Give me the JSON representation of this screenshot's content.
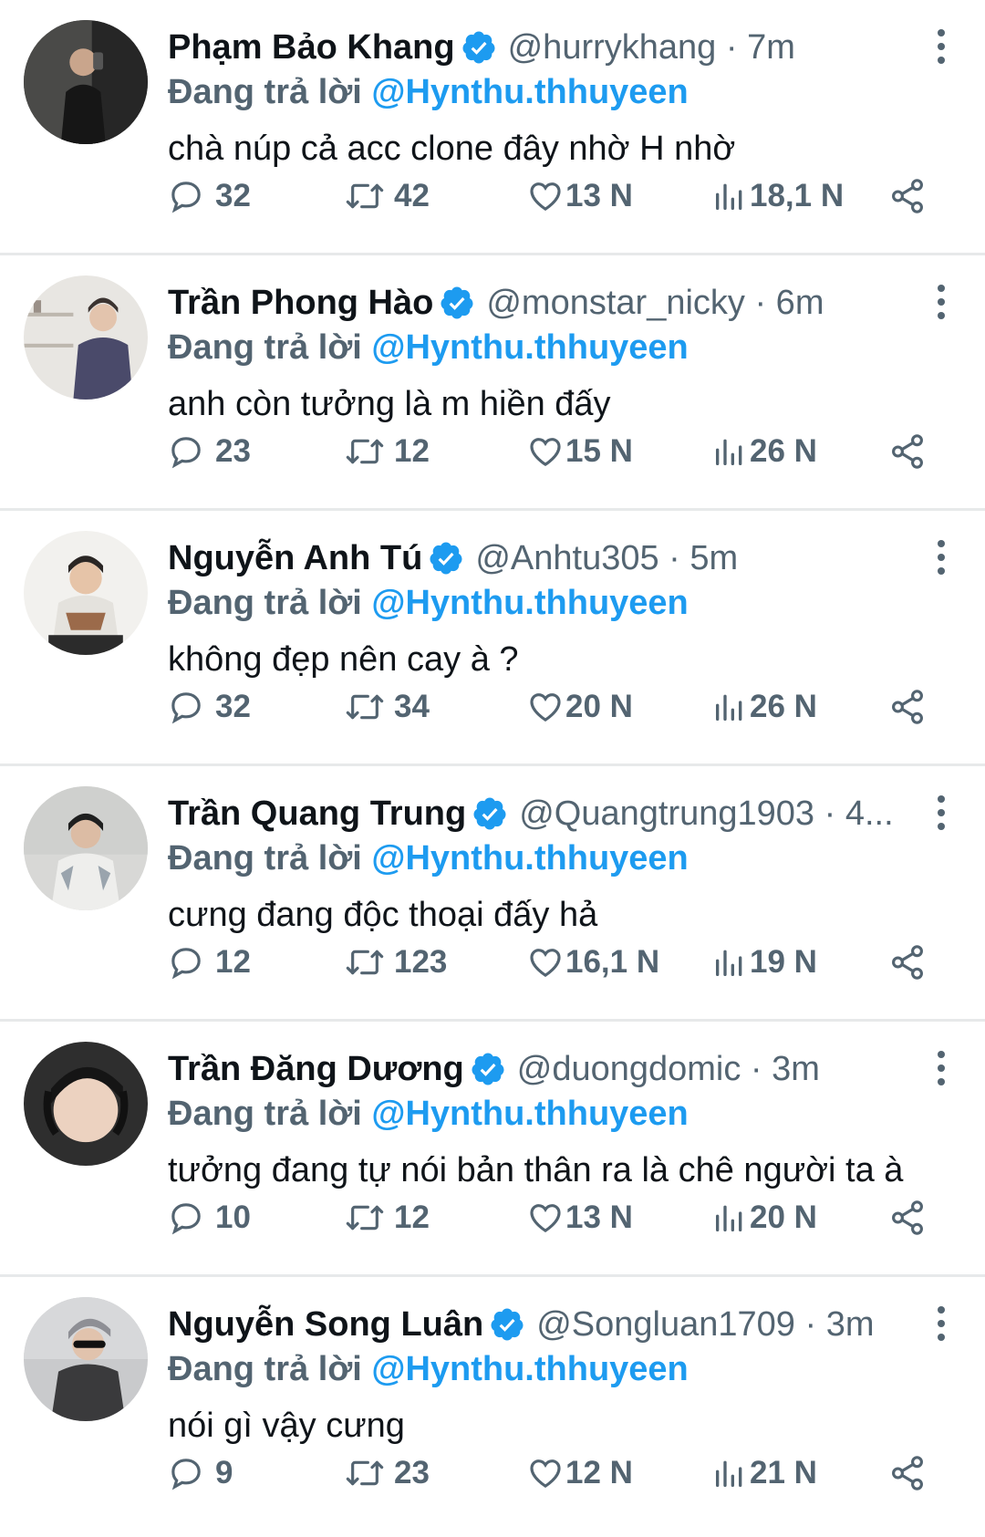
{
  "reply_prefix": "Đang trả lời",
  "colors": {
    "text": "#0f1419",
    "secondary": "#536471",
    "accent": "#1d9bf0",
    "divider": "#e7e9ea"
  },
  "icons": {
    "verified": "verified-badge-icon",
    "reply": "reply-bubble-icon",
    "retweet": "retweet-icon",
    "like": "heart-icon",
    "views": "views-bar-chart-icon",
    "share": "share-icon",
    "more": "more-vertical-icon"
  },
  "tweets": [
    {
      "name": "Phạm Bảo Khang",
      "handle_time": "@hurrykhang · 7m",
      "reply_to": "@Hynthu.thhuyeen",
      "text": "chà núp cả acc clone đây nhờ H nhờ",
      "replies": "32",
      "retweets": "42",
      "likes": "13 N",
      "views": "18,1 N"
    },
    {
      "name": "Trần Phong Hào",
      "handle_time": "@monstar_nicky · 6m",
      "reply_to": "@Hynthu.thhuyeen",
      "text": "anh còn tưởng là m hiền đấy",
      "replies": "23",
      "retweets": "12",
      "likes": "15 N",
      "views": "26 N"
    },
    {
      "name": "Nguyễn Anh Tú",
      "handle_time": "@Anhtu305 · 5m",
      "reply_to": "@Hynthu.thhuyeen",
      "text": "không đẹp nên cay à ?",
      "replies": "32",
      "retweets": "34",
      "likes": "20 N",
      "views": "26 N"
    },
    {
      "name": "Trần Quang Trung",
      "handle_time": "@Quangtrung1903 · 4...",
      "reply_to": "@Hynthu.thhuyeen",
      "text": "cưng đang độc thoại đấy hả",
      "replies": "12",
      "retweets": "123",
      "likes": "16,1 N",
      "views": "19 N"
    },
    {
      "name": "Trần Đăng Dương",
      "handle_time": "@duongdomic · 3m",
      "reply_to": "@Hynthu.thhuyeen",
      "text": "tưởng đang tự nói bản thân ra là chê người ta à",
      "replies": "10",
      "retweets": "12",
      "likes": "13 N",
      "views": "20 N"
    },
    {
      "name": "Nguyễn Song Luân",
      "handle_time": "@Songluan1709 · 3m",
      "reply_to": "@Hynthu.thhuyeen",
      "text": "nói gì vậy cưng",
      "replies": "9",
      "retweets": "23",
      "likes": "12 N",
      "views": "21 N"
    }
  ]
}
